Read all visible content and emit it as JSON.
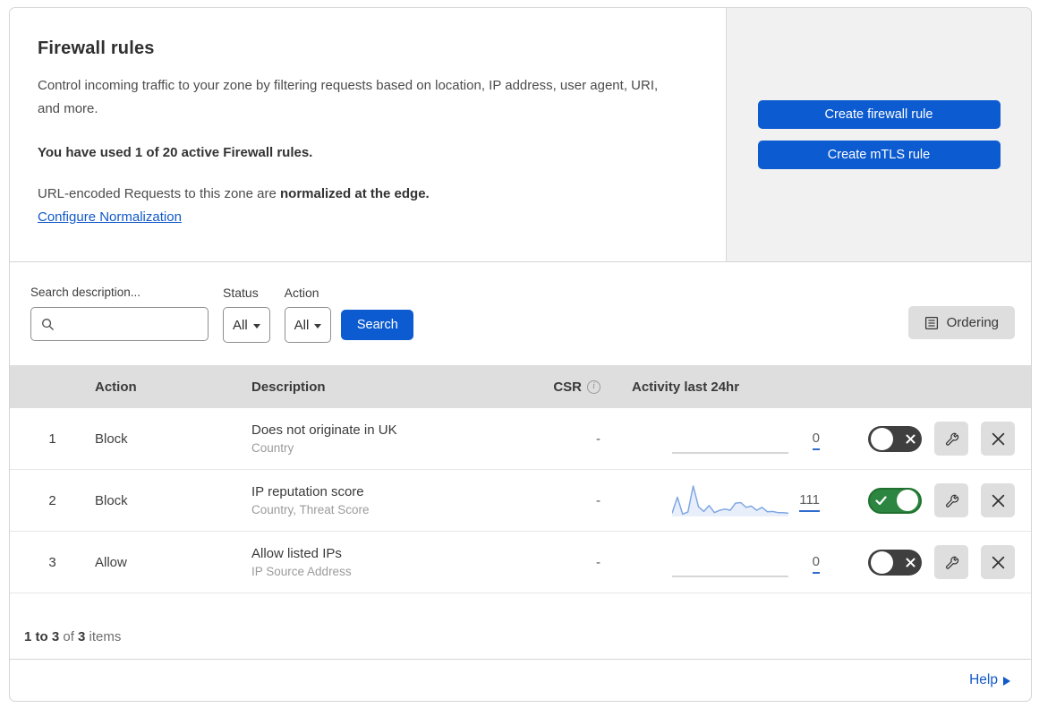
{
  "header": {
    "title": "Firewall rules",
    "description": "Control incoming traffic to your zone by filtering requests based on location, IP address, user agent, URI, and more.",
    "usage_text": "You have used 1 of 20 active Firewall rules.",
    "normalization_text": "URL-encoded Requests to this zone are ",
    "normalization_bold": "normalized at the edge.",
    "normalization_link": "Configure Normalization",
    "create_firewall_button": "Create firewall rule",
    "create_mtls_button": "Create mTLS rule"
  },
  "filters": {
    "search_label": "Search description...",
    "search_value": "",
    "status_label": "Status",
    "status_value": "All",
    "action_label": "Action",
    "action_value": "All",
    "search_button": "Search",
    "ordering_button": "Ordering"
  },
  "table": {
    "columns": {
      "action": "Action",
      "description": "Description",
      "csr": "CSR",
      "activity": "Activity last 24hr"
    },
    "rows": [
      {
        "num": "1",
        "action": "Block",
        "description": "Does not originate in UK",
        "criteria": "Country",
        "csr": "-",
        "activity_count": "0",
        "enabled": false,
        "sparkline": null
      },
      {
        "num": "2",
        "action": "Block",
        "description": "IP reputation score",
        "criteria": "Country, Threat Score",
        "csr": "-",
        "activity_count": "111",
        "enabled": true,
        "sparkline": [
          8,
          62,
          5,
          12,
          100,
          30,
          14,
          34,
          10,
          18,
          22,
          18,
          42,
          44,
          28,
          32,
          18,
          28,
          13,
          14,
          10,
          10,
          8
        ]
      },
      {
        "num": "3",
        "action": "Allow",
        "description": "Allow listed IPs",
        "criteria": "IP Source Address",
        "csr": "-",
        "activity_count": "0",
        "enabled": false,
        "sparkline": null
      }
    ]
  },
  "footer": {
    "range_text": "1 to 3",
    "of_text": " of ",
    "total_text": "3",
    "items_text": " items",
    "help_link": "Help"
  },
  "chart_data": {
    "type": "area",
    "title": "Activity last 24hr sparkline (rule 2: IP reputation score)",
    "x": [
      0,
      1,
      2,
      3,
      4,
      5,
      6,
      7,
      8,
      9,
      10,
      11,
      12,
      13,
      14,
      15,
      16,
      17,
      18,
      19,
      20,
      21,
      22
    ],
    "values": [
      8,
      62,
      5,
      12,
      100,
      30,
      14,
      34,
      10,
      18,
      22,
      18,
      42,
      44,
      28,
      32,
      18,
      28,
      13,
      14,
      10,
      10,
      8
    ],
    "total_label": "111",
    "ylim": [
      0,
      100
    ],
    "grid": false
  },
  "colors": {
    "accent_blue": "#0d5bd0",
    "link_blue": "#1158c9",
    "toggle_on_green": "#2c8540",
    "toggle_on_border": "#20712f",
    "toggle_off_gray": "#3f3f3f",
    "header_band": "#dedede",
    "panel_gray": "#f1f1f1",
    "button_gray": "#dedede",
    "spark_line": "#7fa7e3",
    "spark_fill": "rgba(127,167,227,0.18)",
    "count_underline": "#2f6bce",
    "flat_line": "#d0d0d0"
  }
}
